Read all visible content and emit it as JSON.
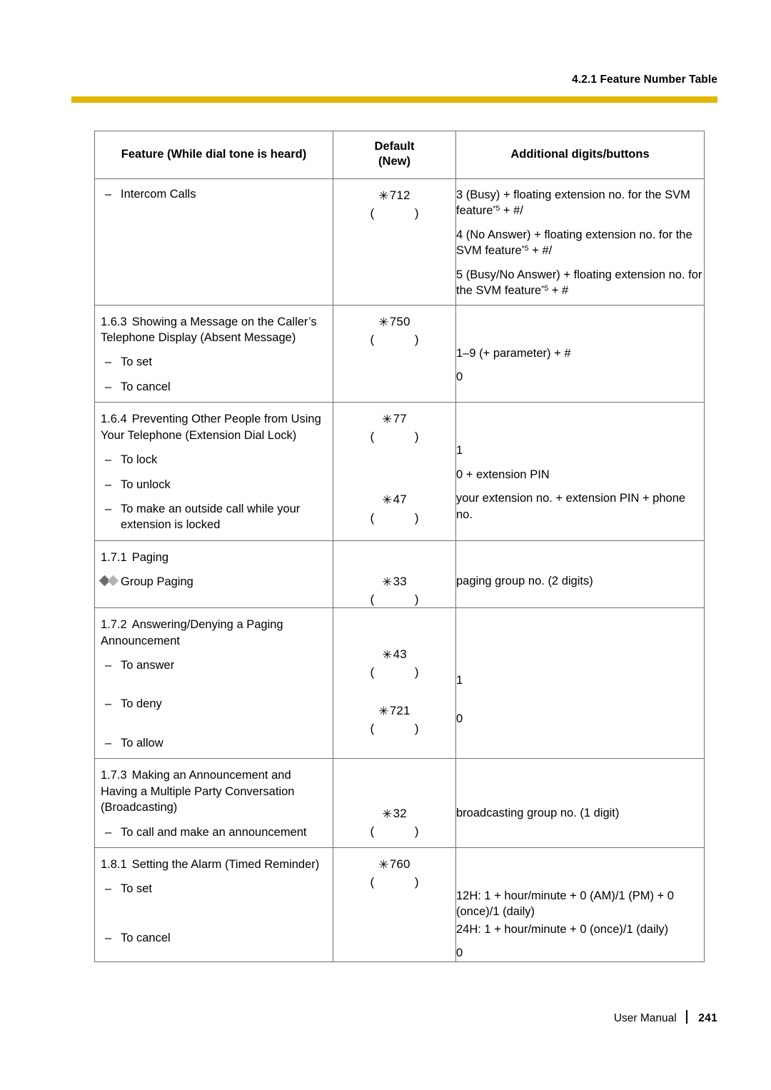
{
  "header": {
    "running_head": "4.2.1 Feature Number Table",
    "rule_color": "#E0B800"
  },
  "footer": {
    "manual_label": "User Manual",
    "page_number": "241"
  },
  "table": {
    "columns": [
      "Feature (While dial tone is heard)",
      {
        "line1": "Default",
        "line2": "(New)"
      },
      "Additional digits/buttons"
    ],
    "col_headers_flat": {
      "feature": "Feature (While dial tone is heard)",
      "default_line1": "Default",
      "default_line2": "(New)",
      "additional": "Additional digits/buttons"
    },
    "empty_parens": "(            )",
    "star_glyph": "✳",
    "rows": [
      {
        "id": "intercom-calls",
        "feature_dash": "–",
        "feature_label": "Intercom Calls",
        "default": "712",
        "extra": [
          {
            "pre": "3 (Busy) + floating extension no. for the SVM feature",
            "sup": "*5",
            "post": " + #/"
          },
          {
            "pre": "4 (No Answer) + floating extension no. for the SVM feature",
            "sup": "*5",
            "post": " + #/"
          },
          {
            "pre": "5 (Busy/No Answer) + floating extension no. for the SVM feature",
            "sup": "*5",
            "post": " + #"
          }
        ]
      },
      {
        "id": "absent-message",
        "section_num": "1.6.3",
        "section_title": "Showing a Message on the Caller’s Telephone Display (Absent Message)",
        "default": "750",
        "items": [
          {
            "dash": "–",
            "label": "To set",
            "extra": "1–9 (+ parameter) + #"
          },
          {
            "dash": "–",
            "label": "To cancel",
            "extra": "0"
          }
        ]
      },
      {
        "id": "extension-dial-lock",
        "section_num": "1.6.4",
        "section_title": "Preventing Other People from Using Your Telephone (Extension Dial Lock)",
        "default": "77",
        "items": [
          {
            "dash": "–",
            "label": "To lock",
            "extra": "1"
          },
          {
            "dash": "–",
            "label": "To unlock",
            "extra": "0 + extension PIN"
          },
          {
            "dash": "–",
            "label": "To make an outside call while your extension is locked",
            "default2": "47",
            "extra": "your extension no. + extension PIN + phone no."
          }
        ]
      },
      {
        "id": "paging",
        "section_num": "1.7.1",
        "section_title": "Paging",
        "items": [
          {
            "marker": "diamonds",
            "label": "Group Paging",
            "default": "33",
            "extra": "paging group no. (2 digits)"
          }
        ]
      },
      {
        "id": "answering-denying-paging",
        "section_num": "1.7.2",
        "section_title": "Answering/Denying a Paging Announcement",
        "items": [
          {
            "dash": "–",
            "label": "To answer",
            "default": "43",
            "extra": ""
          },
          {
            "dash": "–",
            "label": "To deny",
            "default": "721",
            "extra": "1"
          },
          {
            "dash": "–",
            "label": "To allow",
            "extra": "0"
          }
        ]
      },
      {
        "id": "broadcasting",
        "section_num": "1.7.3",
        "section_title": "Making an Announcement and Having a Multiple Party Conversation (Broadcasting)",
        "items": [
          {
            "dash": "–",
            "label": "To call and make an announcement",
            "default": "32",
            "extra": "broadcasting group no. (1 digit)"
          }
        ]
      },
      {
        "id": "timed-reminder",
        "section_num": "1.8.1",
        "section_title": "Setting the Alarm (Timed Reminder)",
        "default": "760",
        "items": [
          {
            "dash": "–",
            "label": "To set",
            "extra_lines": [
              "12H: 1 + hour/minute + 0 (AM)/1 (PM) + 0 (once)/1 (daily)",
              "24H: 1 + hour/minute + 0 (once)/1 (daily)"
            ]
          },
          {
            "dash": "–",
            "label": "To cancel",
            "extra": "0"
          }
        ]
      }
    ]
  }
}
